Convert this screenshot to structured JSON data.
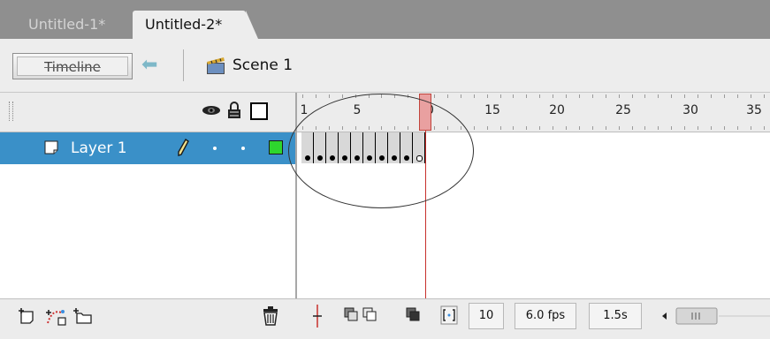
{
  "tabs": [
    {
      "label": "Untitled-1*",
      "active": false
    },
    {
      "label": "Untitled-2*",
      "active": true
    }
  ],
  "editbar": {
    "timeline_label": "Timeline",
    "scene_label": "Scene 1"
  },
  "ruler": {
    "labels": [
      "1",
      "5",
      "10",
      "15",
      "20",
      "25",
      "30",
      "35"
    ]
  },
  "layers": [
    {
      "name": "Layer 1",
      "color": "#2ed62e"
    }
  ],
  "status": {
    "current_frame": "10",
    "frame_rate": "6.0 fps",
    "elapsed_time": "1.5s"
  },
  "colors": {
    "selected_layer": "#3a90c8",
    "playhead": "#c8302c"
  },
  "icons": [
    "eye-icon",
    "lock-icon",
    "outline-icon",
    "pencil-icon",
    "trash-icon",
    "add-layer-icon",
    "motion-guide-icon",
    "add-folder-icon",
    "scene-icon",
    "back-arrow-icon"
  ]
}
